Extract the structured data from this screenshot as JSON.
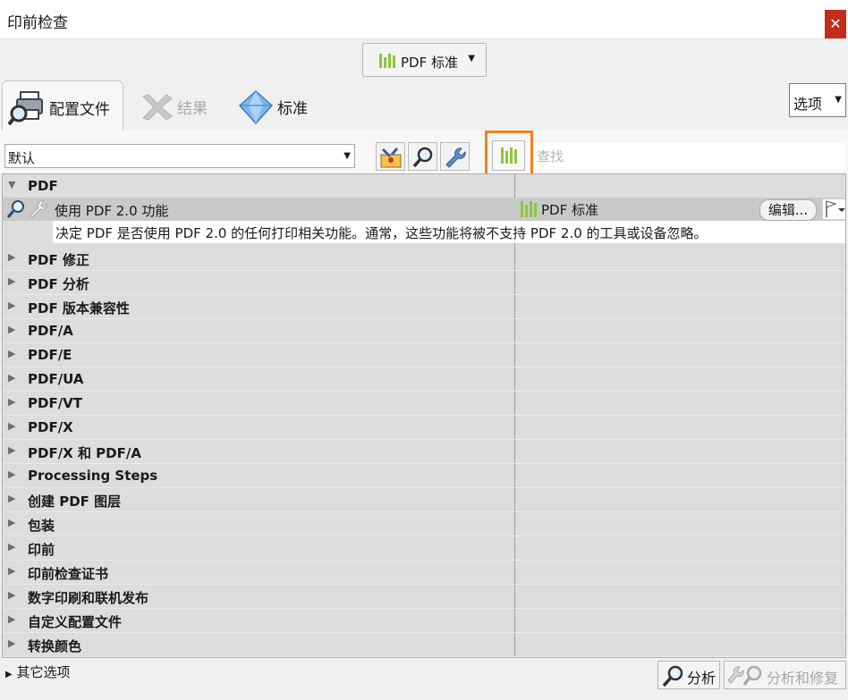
{
  "window": {
    "title": "印前检查",
    "close_glyph": "✕"
  },
  "standard_dropdown": {
    "label": "PDF 标准",
    "icon": "pdf-standards-bars-icon"
  },
  "tabs": [
    {
      "label": "配置文件",
      "icon": "printer-magnifier-icon",
      "active": true
    },
    {
      "label": "结果",
      "icon": "results-icon",
      "enabled": false
    },
    {
      "label": "标准",
      "icon": "diamond-icon"
    }
  ],
  "options_select": {
    "label": "选项"
  },
  "profile_select": {
    "value": "默认"
  },
  "toolbar_icons": [
    "fixups-icon",
    "checks-magnifier-icon",
    "wrench-icon",
    "standards-bars-icon"
  ],
  "search": {
    "placeholder": "查找",
    "value": ""
  },
  "tree": {
    "top_group": {
      "label": "PDF",
      "expanded": true
    },
    "check": {
      "name": "使用 PDF 2.0 功能",
      "standard": "PDF 标准",
      "edit_label": "编辑...",
      "description": "决定 PDF 是否使用 PDF 2.0 的任何打印相关功能。通常，这些功能将被不支持 PDF 2.0 的工具或设备忽略。"
    },
    "groups": [
      "PDF 修正",
      "PDF 分析",
      "PDF 版本兼容性",
      "PDF/A",
      "PDF/E",
      "PDF/UA",
      "PDF/VT",
      "PDF/X",
      "PDF/X 和 PDF/A",
      "Processing Steps",
      "创建 PDF 图层",
      "包装",
      "印前",
      "印前检查证书",
      "数字印刷和联机发布",
      "自定义配置文件",
      "转换颜色"
    ]
  },
  "bottom": {
    "more_options": "其它选项",
    "analyze": "分析",
    "analyze_fix": "分析和修复"
  },
  "colors": {
    "highlight": "#f0831e",
    "accent_green": "#8cc63f",
    "close_red": "#c42b1c"
  }
}
